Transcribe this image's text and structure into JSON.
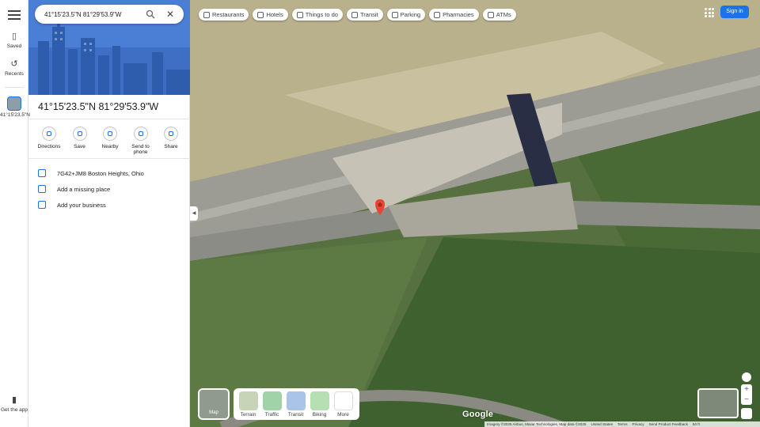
{
  "search": {
    "value": "41°15'23.5\"N 81°29'53.9\"W"
  },
  "rail": {
    "saved": "Saved",
    "recents": "Recents",
    "current": "41°15'23.5\"N",
    "get_app": "Get the app"
  },
  "place": {
    "title": "41°15'23.5\"N 81°29'53.9\"W",
    "actions": [
      {
        "label": "Directions"
      },
      {
        "label": "Save"
      },
      {
        "label": "Nearby"
      },
      {
        "label": "Send to phone"
      },
      {
        "label": "Share"
      }
    ],
    "plus_code": "7G42+JM8 Boston Heights, Ohio",
    "add_missing": "Add a missing place",
    "add_business": "Add your business"
  },
  "chips": [
    {
      "label": "Restaurants",
      "icon": "restaurant-icon"
    },
    {
      "label": "Hotels",
      "icon": "hotel-icon"
    },
    {
      "label": "Things to do",
      "icon": "camera-icon"
    },
    {
      "label": "Transit",
      "icon": "transit-icon"
    },
    {
      "label": "Parking",
      "icon": "parking-icon"
    },
    {
      "label": "Pharmacies",
      "icon": "pharmacy-icon"
    },
    {
      "label": "ATMs",
      "icon": "atm-icon"
    }
  ],
  "header": {
    "sign_in": "Sign in"
  },
  "layers": {
    "current": "Map",
    "options": [
      {
        "label": "Terrain",
        "color": "#c8d4b8"
      },
      {
        "label": "Traffic",
        "color": "#9fd3a8"
      },
      {
        "label": "Transit",
        "color": "#a9c4e8"
      },
      {
        "label": "Biking",
        "color": "#b7dfb4"
      },
      {
        "label": "More",
        "color": "#ffffff"
      }
    ]
  },
  "footer": {
    "logo": "Google",
    "imagery": "Imagery ©2025 Airbus, Maxar Technologies, Map data ©2025",
    "country": "United States",
    "terms": "Terms",
    "privacy": "Privacy",
    "feedback": "Send Product Feedback",
    "scale": "50 ft"
  },
  "colors": {
    "accent": "#1a73e8",
    "pin": "#ea4335"
  }
}
